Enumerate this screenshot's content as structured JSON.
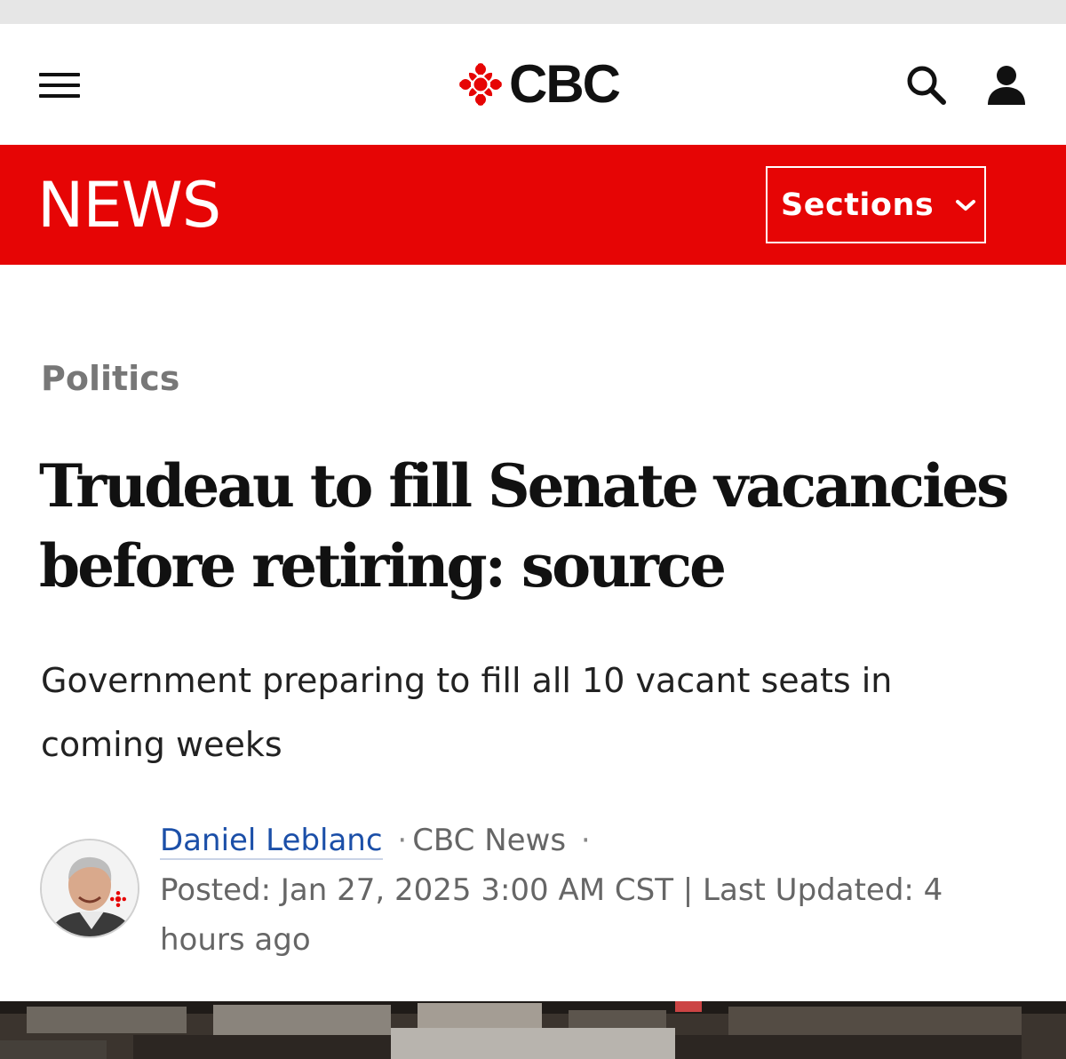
{
  "header": {
    "brand": "CBC",
    "menu_icon": "hamburger-menu-icon",
    "search_icon": "search-icon",
    "account_icon": "account-icon"
  },
  "news_bar": {
    "title": "NEWS",
    "sections_label": "Sections",
    "sections_icon": "chevron-down-icon",
    "color": "#e60505"
  },
  "article": {
    "category": "Politics",
    "headline": "Trudeau to fill Senate vacancies before retiring: source",
    "deck": "Government preparing to fill all 10 vacant seats in coming weeks",
    "author": "Daniel Leblanc",
    "separator": "·",
    "outlet": "CBC News",
    "posted": "Posted: Jan 27, 2025 3:00 AM CST | Last Updated: 4 hours ago"
  },
  "colors": {
    "brand_red": "#e60505",
    "author_link": "#1b4fa8",
    "category_gray": "#777777"
  }
}
